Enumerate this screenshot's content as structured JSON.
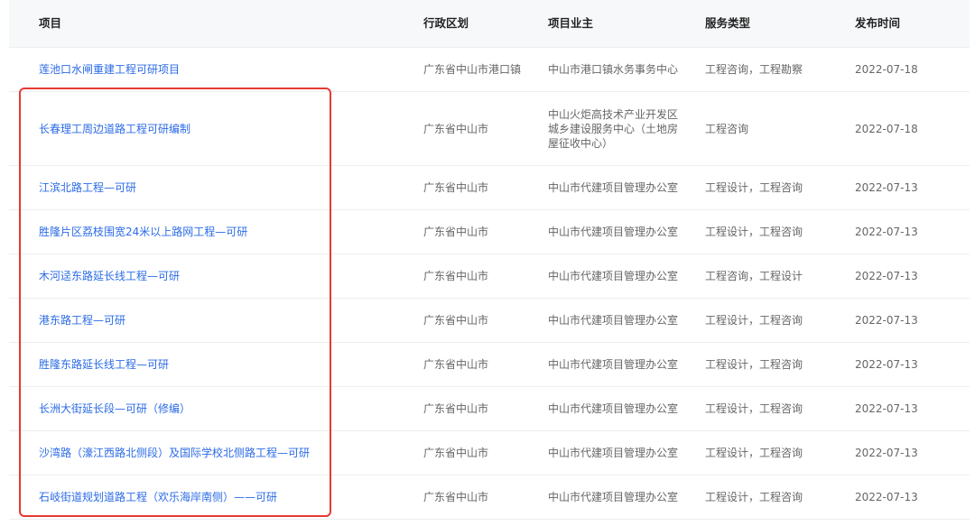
{
  "headers": {
    "name": "项目",
    "region": "行政区划",
    "owner": "项目业主",
    "service": "服务类型",
    "date": "发布时间"
  },
  "rows": [
    {
      "name": "莲池口水闸重建工程可研项目",
      "region": "广东省中山市港口镇",
      "owner": "中山市港口镇水务事务中心",
      "service": "工程咨询，工程勘察",
      "date": "2022-07-18"
    },
    {
      "name": "长春理工周边道路工程可研编制",
      "region": "广东省中山市",
      "owner": "中山火炬高技术产业开发区城乡建设服务中心（土地房屋征收中心）",
      "service": "工程咨询",
      "date": "2022-07-18"
    },
    {
      "name": "江滨北路工程—可研",
      "region": "广东省中山市",
      "owner": "中山市代建项目管理办公室",
      "service": "工程设计，工程咨询",
      "date": "2022-07-13"
    },
    {
      "name": "胜隆片区荔枝围宽24米以上路网工程—可研",
      "region": "广东省中山市",
      "owner": "中山市代建项目管理办公室",
      "service": "工程设计，工程咨询",
      "date": "2022-07-13"
    },
    {
      "name": "木河迳东路延长线工程—可研",
      "region": "广东省中山市",
      "owner": "中山市代建项目管理办公室",
      "service": "工程咨询，工程设计",
      "date": "2022-07-13"
    },
    {
      "name": "港东路工程—可研",
      "region": "广东省中山市",
      "owner": "中山市代建项目管理办公室",
      "service": "工程设计，工程咨询",
      "date": "2022-07-13"
    },
    {
      "name": "胜隆东路延长线工程—可研",
      "region": "广东省中山市",
      "owner": "中山市代建项目管理办公室",
      "service": "工程设计，工程咨询",
      "date": "2022-07-13"
    },
    {
      "name": "长洲大街延长段—可研（修编）",
      "region": "广东省中山市",
      "owner": "中山市代建项目管理办公室",
      "service": "工程设计，工程咨询",
      "date": "2022-07-13"
    },
    {
      "name": "沙湾路（濠江西路北侧段）及国际学校北侧路工程—可研",
      "region": "广东省中山市",
      "owner": "中山市代建项目管理办公室",
      "service": "工程设计，工程咨询",
      "date": "2022-07-13"
    },
    {
      "name": "石岐街道规划道路工程（欢乐海岸南侧）——可研",
      "region": "广东省中山市",
      "owner": "中山市代建项目管理办公室",
      "service": "工程设计，工程咨询",
      "date": "2022-07-13"
    }
  ],
  "accent_color": "#2b6be6",
  "highlight_color": "#e53a32"
}
